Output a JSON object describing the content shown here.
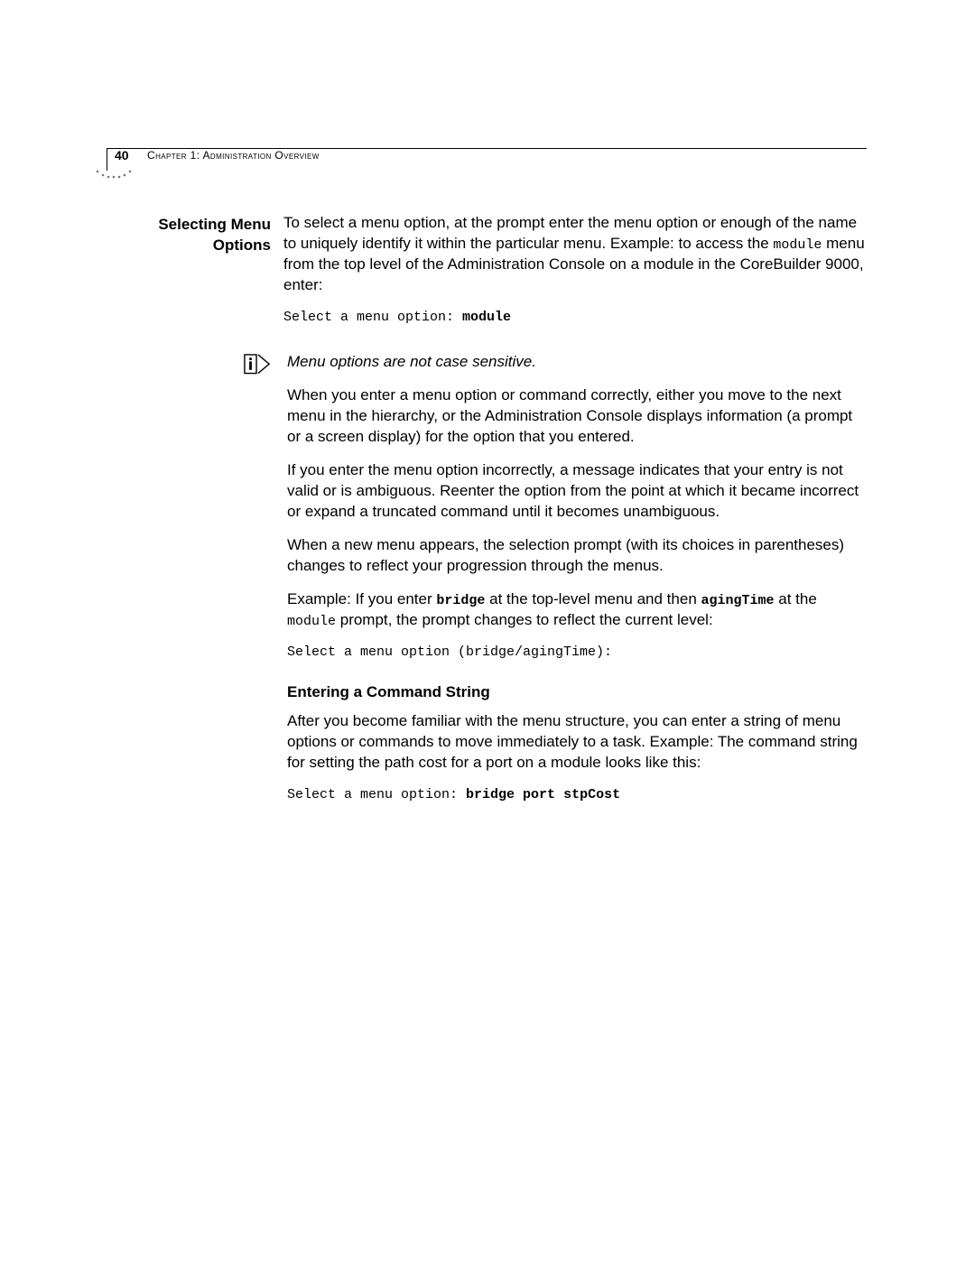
{
  "header": {
    "page_number": "40",
    "chapter_label": "Chapter 1: Administration Overview"
  },
  "section": {
    "side_heading_line1": "Selecting Menu",
    "side_heading_line2": "Options",
    "intro_part1": "To select a menu option, at the prompt enter the menu option or enough of the name to uniquely identify it within the particular menu. Example: to access the ",
    "intro_code1": "module",
    "intro_part2": " menu from the top level of the Administration Console on a module in the CoreBuilder 9000, enter:",
    "code_prompt1_a": "Select a menu option: ",
    "code_prompt1_b": "module",
    "note": "Menu options are not case sensitive.",
    "para2": "When you enter a menu option or command correctly, either you move to the next menu in the hierarchy, or the Administration Console displays information (a prompt or a screen display) for the option that you entered.",
    "para3": "If you enter the menu option incorrectly, a message indicates that your entry is not valid or is ambiguous. Reenter the option from the point at which it became incorrect or expand a truncated command until it becomes unambiguous.",
    "para4": "When a new menu appears, the selection prompt (with its choices in parentheses) changes to reflect your progression through the menus.",
    "para5_a": "Example: If you enter ",
    "para5_code1": "bridge",
    "para5_b": " at the top-level menu and then ",
    "para5_code2": "agingTime",
    "para5_c": " at the ",
    "para5_code3": "module",
    "para5_d": " prompt, the prompt changes to reflect the current level:",
    "code_prompt2": "Select a menu option (bridge/agingTime):",
    "subheading": "Entering a Command String",
    "para6": "After you become familiar with the menu structure, you can enter a string of menu options or commands to move immediately to a task. Example: The command string for setting the path cost for a port on a module looks like this:",
    "code_prompt3_a": "Select a menu option: ",
    "code_prompt3_b": "bridge port stpCost"
  }
}
